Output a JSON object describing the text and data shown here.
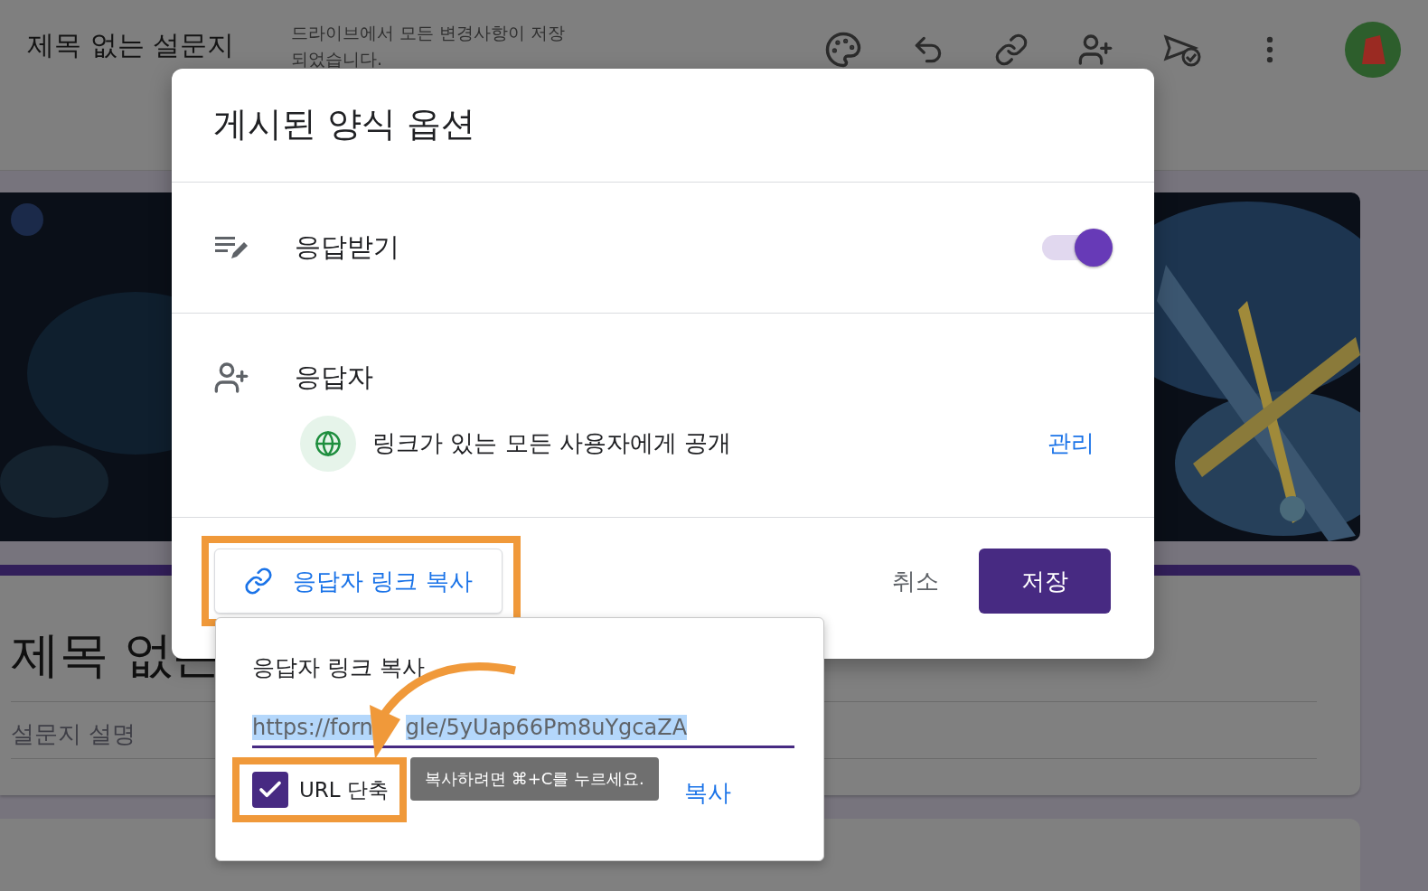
{
  "app_bar": {
    "title": "제목 없는 설문지",
    "save_status": "드라이브에서 모든 변경사항이 저장되었습니다."
  },
  "form": {
    "title": "제목 없는",
    "description_placeholder": "설문지 설명"
  },
  "dialog": {
    "title": "게시된 양식 옵션",
    "rows": [
      {
        "kind": "toggle",
        "label": "응답받기",
        "on": true
      },
      {
        "kind": "audience",
        "label": "응답자",
        "access": "링크가 있는 모든 사용자에게 공개",
        "action": "관리"
      }
    ],
    "copy_link_button": "응답자 링크 복사",
    "cancel": "취소",
    "save": "저장"
  },
  "link_popup": {
    "title": "응답자 링크 복사",
    "url": [
      "https://forn",
      "gle/5yUap66Pm8uYgcaZA"
    ],
    "shorten": {
      "label": "URL 단축",
      "checked": true
    },
    "tooltip": "복사하려면 ⌘+C를 누르세요.",
    "copy": "복사"
  }
}
